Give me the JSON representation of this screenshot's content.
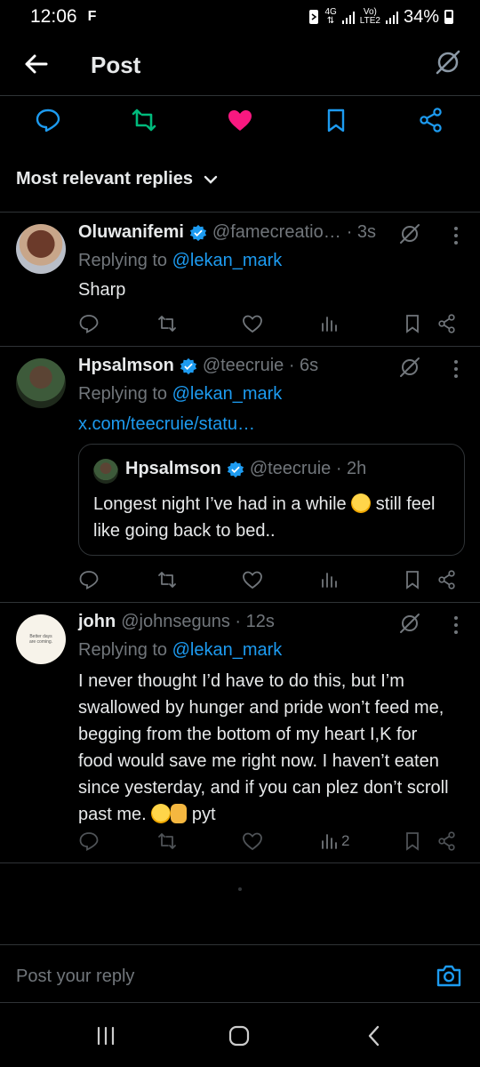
{
  "status": {
    "time": "12:06",
    "left_icon": "F",
    "network_top": "4G",
    "network_label": "Vo)",
    "network_label2": "LTE2",
    "battery": "34%"
  },
  "header": {
    "title": "Post"
  },
  "sort": {
    "label": "Most relevant replies"
  },
  "posts": [
    {
      "name": "Oluwanifemi",
      "handle": "@famecreatio…",
      "time": "· 3s",
      "replying_prefix": "Replying to ",
      "replying_to": "@lekan_mark",
      "text": "Sharp"
    },
    {
      "name": "Hpsalmson",
      "handle": "@teecruie · 6s",
      "replying_prefix": "Replying to ",
      "replying_to": "@lekan_mark",
      "link": "x.com/teecruie/statu…",
      "quote": {
        "name": "Hpsalmson",
        "handle": "@teecruie · 2h",
        "text_before": "Longest night I’ve had in a while ",
        "text_after": " still feel like going back to bed.."
      }
    },
    {
      "name": "john",
      "handle": "@johnseguns · 12s",
      "replying_prefix": "Replying to ",
      "replying_to": "@lekan_mark",
      "text": "I never thought I’d have to do this, but I’m swallowed by hunger and pride won’t feed me, begging from the bottom of my heart I,K for food would  save me right now. I haven’t eaten since yesterday, and if you can plez don’t scroll past me.",
      "text_tail": " pyt",
      "views": "2",
      "avatar_text": "Better days are coming."
    }
  ],
  "compose": {
    "placeholder": "Post your reply"
  },
  "colors": {
    "accent": "#1d9bf0",
    "retweet": "#00ba7c",
    "like": "#f91880",
    "muted": "#71767b",
    "border": "#2f3336"
  }
}
